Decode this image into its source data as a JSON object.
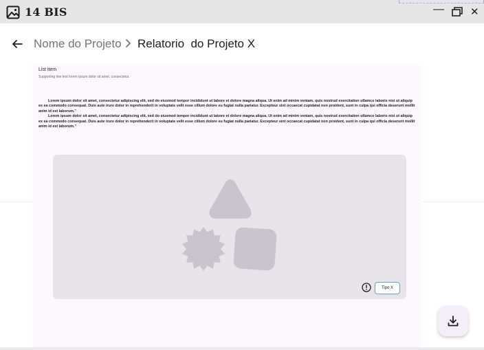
{
  "window": {
    "title": "14 BIS",
    "icons": {
      "app": "image-icon",
      "minimize": "minimize-icon",
      "maximize": "restore-icon",
      "close": "close-icon"
    }
  },
  "breadcrumb": {
    "parent": "Nome do Projeto",
    "current": "Relatorio  do Projeto X",
    "icons": {
      "back": "arrow-left-icon",
      "separator": "chevron-right-icon"
    }
  },
  "content": {
    "list_item": {
      "title": "List item",
      "supporting": "Supporting line text lorem ipsum dolor sit amet, consectetur."
    },
    "paragraphs": [
      "Lorem ipsum dolor sit amet, consectetur adipiscing elit, sed do eiusmod tempor incididunt ut labore et dolore magna aliqua. Ut enim ad minim veniam, quis nostrud exercitation ullamco laboris nisi ut aliquip ex ea commodo consequat. Duis aute irure dolor in reprehenderit in voluptate velit esse cillum dolore eu fugiat nulla pariatur. Excepteur sint occaecat cupidatat non proident, sunt in culpa qui officia deserunt mollit anim id est laborum.\"",
      "Lorem ipsum dolor sit amet, consectetur adipiscing elit, sed do eiusmod tempor incididunt ut labore et dolore magna aliqua. Ut enim ad minim veniam, quis nostrud exercitation ullamco laboris nisi ut aliquip ex ea commodo consequat. Duis aute irure dolor in reprehenderit in voluptate velit esse cillum dolore eu fugiat nulla pariatur. Excepteur sint occaecat cupidatat non proident, sunt in culpa qui officia deserunt mollit anim id est laborum.\""
    ],
    "media": {
      "placeholder_icon": "shapes-placeholder-icon",
      "info_icon": "alert-circle-icon",
      "chip_label": "Tipo X"
    }
  },
  "fab": {
    "icon": "download-icon"
  },
  "colors": {
    "titlebar_bg": "#e6e6e6",
    "card_bg": "#fcf8fe",
    "media_bg": "#e8e4ea",
    "shape_fill": "#cbc4ce",
    "chip_border": "#6aa0c8",
    "breadcrumb_parent": "#7a6f7c"
  }
}
